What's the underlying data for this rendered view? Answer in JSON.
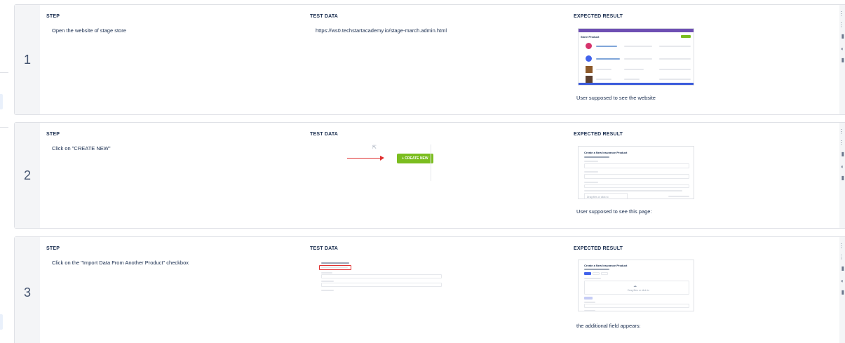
{
  "labels": {
    "step": "STEP",
    "test_data": "TEST DATA",
    "expected_result": "EXPECTED RESULT"
  },
  "steps": [
    {
      "number": "1",
      "step": "Open the website of stage store",
      "test_data": "https://ws0.techstartacademy.io/stage-march.admin.html",
      "expected": "User supposed to see the website",
      "thumb": {
        "header": "Store Product",
        "add_label": "+"
      }
    },
    {
      "number": "2",
      "step": "Click on \"CREATE NEW\"",
      "test_data": "",
      "test_button": "+ CREATE NEW",
      "expected": "User supposed to see this page:",
      "thumb": {
        "title": "Create a New Insurance Product",
        "drop_label": "Drag files or click to"
      }
    },
    {
      "number": "3",
      "step": "Click on the \"Import Data From Another Product\" checkbox",
      "test_data": "",
      "expected": "the additional field appears:",
      "thumb": {
        "title": "Create a New Insurance Product",
        "drop_label": "Drag files or click to"
      }
    }
  ],
  "colors": {
    "accent_green": "#7bbd1f",
    "arrow_red": "#e03131",
    "header_purple": "#6e4fb3"
  }
}
